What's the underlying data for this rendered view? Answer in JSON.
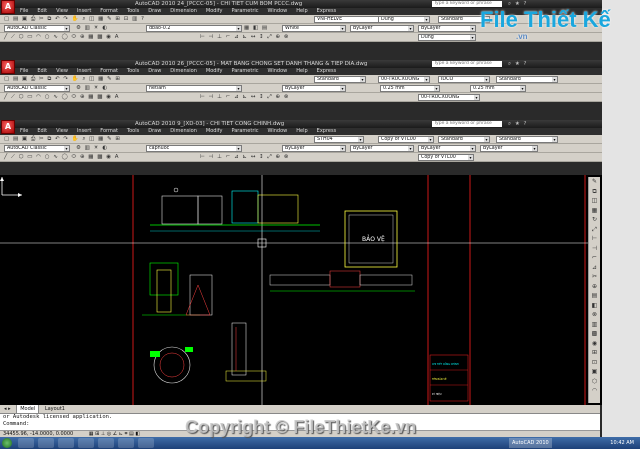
{
  "windows": [
    {
      "title": "AutoCAD 2010     24_[PCCC-05] - CHI TIET CUM BOM PCCC.dwg",
      "search_placeholder": "Type a keyword or phrase",
      "menus": [
        "File",
        "Edit",
        "View",
        "Insert",
        "Format",
        "Tools",
        "Draw",
        "Dimension",
        "Modify",
        "Parametric",
        "Window",
        "Help",
        "Express"
      ],
      "workspace": "AutoCAD Classic",
      "layer": "dbao-0.2",
      "color": "White",
      "text_style": "VNI-HELVE",
      "dim_style": "Dung",
      "table_style": "Standard",
      "linetype": "ByLayer",
      "lineweight": "ByLayer",
      "plot_style": "Dung"
    },
    {
      "title": "AutoCAD 2010     26_[PCCC-05] - MAT BANG CHONG SET DANH THANG & TIEP DIA.dwg",
      "search_placeholder": "Type a keyword or phrase",
      "menus": [
        "File",
        "Edit",
        "View",
        "Insert",
        "Format",
        "Tools",
        "Draw",
        "Dimension",
        "Modify",
        "Parametric",
        "Window",
        "Help",
        "Express"
      ],
      "workspace": "AutoCAD Classic",
      "layer": "netlam",
      "color": "ByLayer",
      "text_style": "Standard",
      "dim_style": "00-TRUCXUONG",
      "table_style": "IDCO",
      "lineweight": "0.25 mm",
      "lineweight2": "0.25 mm",
      "extra": "Standard",
      "plot_style": "00-TRUCXUONG"
    },
    {
      "title": "AutoCAD 2010     9_[XD-03] - CHI TIET CONG CHINH.dwg",
      "search_placeholder": "Type a keyword or phrase",
      "menus": [
        "File",
        "Edit",
        "View",
        "Insert",
        "Format",
        "Tools",
        "Draw",
        "Dimension",
        "Modify",
        "Parametric",
        "Window",
        "Help",
        "Express"
      ],
      "workspace": "AutoCAD Classic",
      "layer": "capnuoc",
      "color": "ByLayer",
      "text_style": "STH04",
      "dim_style": "Copy of VTL00",
      "table_style": "Standard",
      "linetype": "ByLayer",
      "lineweight": "ByLayer",
      "plot_style": "ByLayer",
      "named_style": "Copy of VTL00"
    }
  ],
  "drawing": {
    "label_box": "BẢO VỆ",
    "titleblock_lines": [
      "CHI TIẾT CỔNG CHÍNH",
      "TÊN BẢN VẼ",
      "KÝ HIỆU"
    ]
  },
  "tabs": [
    "Model",
    "Layout1"
  ],
  "command_lines": [
    "or Autodesk licensed application.",
    "Command:"
  ],
  "status_coords": "34455.96, -14.0000, 0.0000",
  "taskbar": {
    "app_label": "AutoCAD 2010",
    "clock": "10:42 AM"
  },
  "logo": {
    "main": "File Thiết Kế",
    "sub": ".vn"
  },
  "watermark": "Copyright © FileThietKe.vn",
  "colors": {
    "accent": "#1aa7de",
    "canvas": "#000000",
    "red": "#ff2020",
    "green": "#00ff00",
    "cyan": "#00ffff"
  }
}
